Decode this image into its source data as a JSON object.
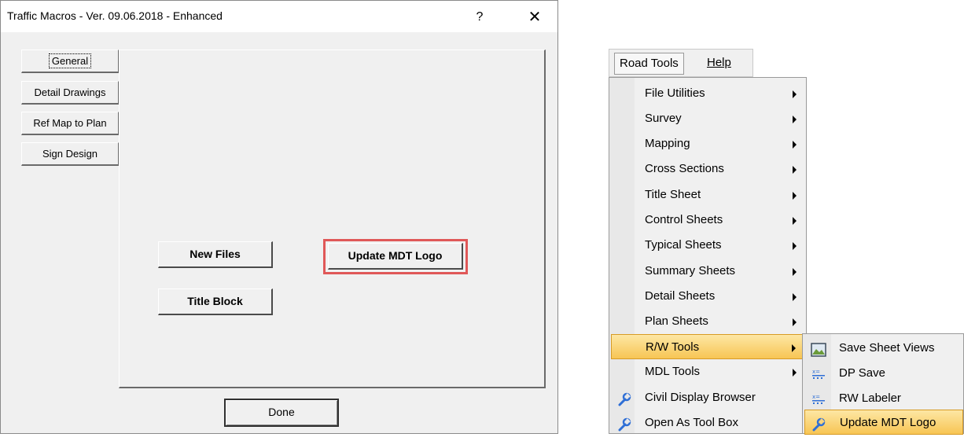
{
  "dialog": {
    "title": "Traffic Macros - Ver. 09.06.2018 - Enhanced",
    "help_label": "?",
    "close_label": "✕",
    "tabs": [
      {
        "label": "General",
        "active": true
      },
      {
        "label": "Detail Drawings",
        "active": false
      },
      {
        "label": "Ref Map to Plan",
        "active": false
      },
      {
        "label": "Sign Design",
        "active": false
      }
    ],
    "buttons": {
      "new_files": "New Files",
      "update_logo": "Update MDT Logo",
      "title_block": "Title Block",
      "done": "Done"
    },
    "highlight_color": "#e05858"
  },
  "menubar": {
    "items": [
      {
        "label": "Road Tools",
        "open": true
      },
      {
        "label": "Help",
        "open": false
      }
    ]
  },
  "menu": {
    "items": [
      {
        "label": "File Utilities",
        "submenu": true,
        "icon": null
      },
      {
        "label": "Survey",
        "submenu": true,
        "icon": null
      },
      {
        "label": "Mapping",
        "submenu": true,
        "icon": null
      },
      {
        "label": "Cross Sections",
        "submenu": true,
        "icon": null
      },
      {
        "label": "Title Sheet",
        "submenu": true,
        "icon": null
      },
      {
        "label": "Control Sheets",
        "submenu": true,
        "icon": null
      },
      {
        "label": "Typical Sheets",
        "submenu": true,
        "icon": null
      },
      {
        "label": "Summary Sheets",
        "submenu": true,
        "icon": null
      },
      {
        "label": "Detail Sheets",
        "submenu": true,
        "icon": null
      },
      {
        "label": "Plan Sheets",
        "submenu": true,
        "icon": null
      },
      {
        "label": "R/W Tools",
        "submenu": true,
        "icon": null,
        "highlighted": true
      },
      {
        "label": "MDL Tools",
        "submenu": true,
        "icon": null
      },
      {
        "label": "Civil Display Browser",
        "submenu": false,
        "icon": "wrench-icon"
      },
      {
        "label": "Open As Tool Box",
        "submenu": false,
        "icon": "wrench-icon"
      }
    ]
  },
  "submenu": {
    "items": [
      {
        "label": "Save Sheet Views",
        "icon": "sheet-view-icon"
      },
      {
        "label": "DP Save",
        "icon": "dots-grid-icon"
      },
      {
        "label": "RW Labeler",
        "icon": "dots-grid-icon"
      },
      {
        "label": "Update MDT Logo",
        "icon": "wrench-icon",
        "highlighted": true
      }
    ]
  },
  "colors": {
    "hover_top": "#fde7a4",
    "hover_bottom": "#f7c554",
    "hover_border": "#d79b25"
  }
}
